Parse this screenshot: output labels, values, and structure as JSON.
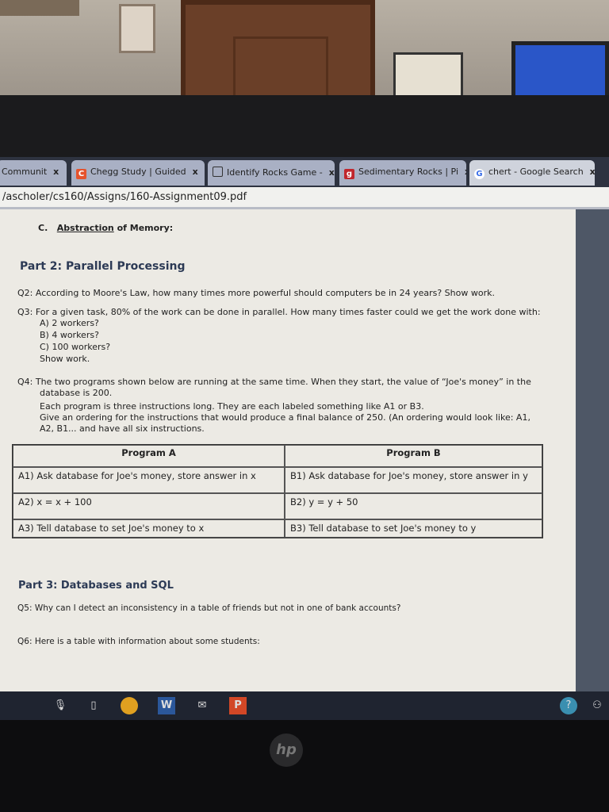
{
  "browser": {
    "tabs": [
      {
        "label": "Communit",
        "icon": "page-icon"
      },
      {
        "label": "Chegg Study | Guided",
        "icon": "chegg-icon"
      },
      {
        "label": "Identify Rocks Game -",
        "icon": "document-icon"
      },
      {
        "label": "Sedimentary Rocks | Pi",
        "icon": "g-red-icon"
      },
      {
        "label": "chert - Google Search",
        "icon": "google-icon"
      }
    ],
    "close_glyph": "x",
    "address": "/ascholer/cs160/Assigns/160-Assignment09.pdf"
  },
  "doc": {
    "c_item": {
      "prefix": "C.",
      "underlined": "Abstraction",
      "rest": " of Memory:"
    },
    "part2": "Part 2: Parallel Processing",
    "q2": "Q2: According to Moore's Law, how many times more powerful should computers be in 24 years? Show work.",
    "q3": "Q3: For a given task, 80% of the work can be done in parallel. How many times faster could we get the work done with:",
    "q3_options": [
      "A) 2 workers?",
      "B) 4 workers?",
      "C) 100 workers?",
      "Show work."
    ],
    "q4_lines": [
      "Q4: The two programs shown below are running at the same time. When they start, the value of “Joe's money” in the",
      "database is 200.",
      "Each program is three instructions long. They are each labeled something like A1 or B3.",
      "Give an ordering for the instructions that would produce a final balance of 250. (An ordering would look like: A1,",
      "A2, B1... and have all six instructions."
    ],
    "table": {
      "headers": [
        "Program A",
        "Program B"
      ],
      "rows": [
        [
          "A1) Ask database for Joe's money, store answer in x",
          "B1) Ask database for Joe's money, store answer in y"
        ],
        [
          "A2) x = x + 100",
          "B2) y = y + 50"
        ],
        [
          "A3) Tell database to set Joe's money to x",
          "B3) Tell database to set Joe's money to y"
        ]
      ]
    },
    "part3": "Part 3: Databases and SQL",
    "q5": "Q5: Why can I detect an inconsistency in a table of friends but not in one of bank accounts?",
    "q6": "Q6:  Here is a table with information about some students:"
  },
  "taskbar": {
    "icons": [
      "microphone-icon",
      "task-view-icon",
      "chrome-icon",
      "word-icon",
      "mail-icon",
      "powerpoint-icon",
      "help-icon",
      "people-icon"
    ]
  },
  "laptop": {
    "logo": "hp"
  }
}
